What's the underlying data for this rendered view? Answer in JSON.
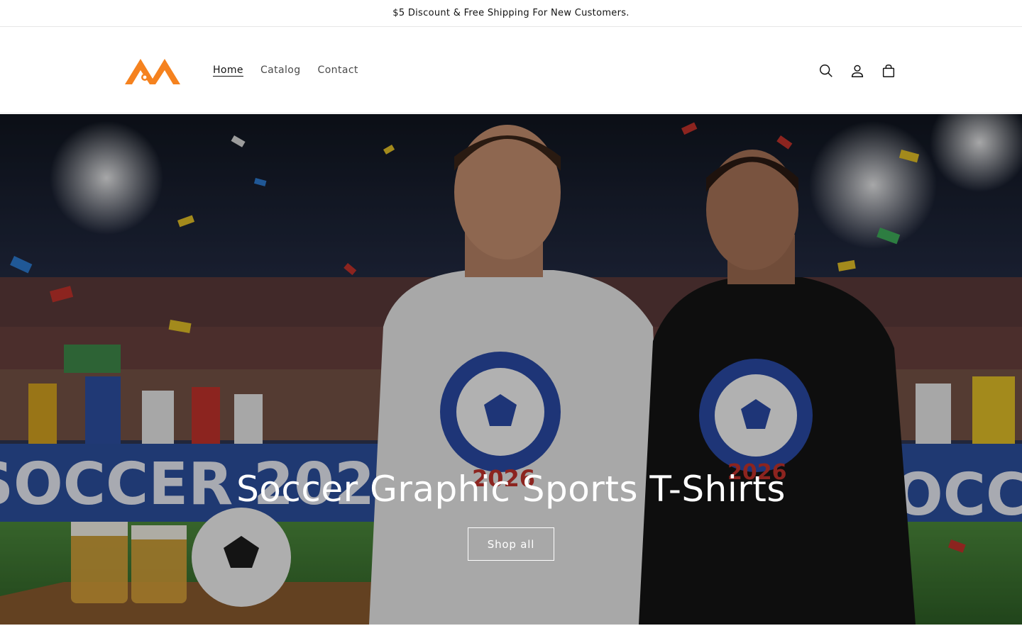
{
  "announcement": {
    "text": "$5 Discount & Free Shipping For New Customers."
  },
  "brand": {
    "accent": "#f5821f"
  },
  "nav": {
    "items": [
      {
        "label": "Home",
        "active": true
      },
      {
        "label": "Catalog",
        "active": false
      },
      {
        "label": "Contact",
        "active": false
      }
    ]
  },
  "header_icons": [
    "search-icon",
    "account-icon",
    "cart-icon"
  ],
  "hero": {
    "title": "Soccer Graphic Sports T-Shirts",
    "button_label": "Shop all",
    "banner_text": "SOCCER 2026",
    "shirt_text": "2026"
  }
}
